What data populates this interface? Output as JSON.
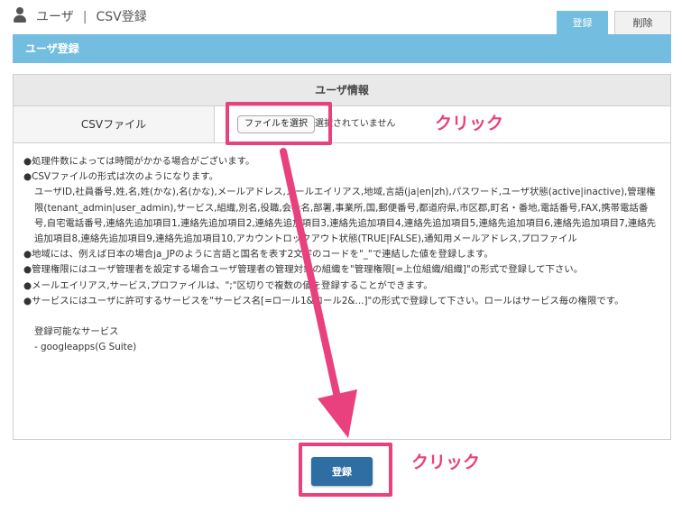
{
  "header": {
    "icon": "user-icon",
    "section": "ユーザ",
    "separator": "|",
    "page": "CSV登録"
  },
  "tabs": [
    {
      "label": "登録",
      "active": true
    },
    {
      "label": "削除",
      "active": false
    }
  ],
  "section_title": "ユーザ登録",
  "form": {
    "panel_title": "ユーザ情報",
    "csv_label": "CSVファイル",
    "file_button": "ファイルを選択",
    "file_status": "選択されていません"
  },
  "info_lines": [
    "●処理件数によっては時間がかかる場合がございます。",
    "●CSVファイルの形式は次のようになります。",
    "ユーザID,社員番号,姓,名,姓(かな),名(かな),メールアドレス,メールエイリアス,地域,言語(ja|en|zh),パスワード,ユーザ状態(active|inactive),管理権限(tenant_admin|user_admin),サービス,組織,別名,役職,会社名,部署,事業所,国,郵便番号,都道府県,市区郡,町名・番地,電話番号,FAX,携帯電話番号,自宅電話番号,連絡先追加項目1,連絡先追加項目2,連絡先追加項目3,連絡先追加項目4,連絡先追加項目5,連絡先追加項目6,連絡先追加項目7,連絡先追加項目8,連絡先追加項目9,連絡先追加項目10,アカウントロックアウト状態(TRUE|FALSE),通知用メールアドレス,プロファイル",
    "●地域には、例えば日本の場合ja_JPのように言語と国名を表す2文字のコードを\"_\"で連結した値を登録します。",
    "●管理権限にはユーザ管理者を設定する場合ユーザ管理者の管理対象の組織を\"管理権限[=上位組織/組織]\"の形式で登録して下さい。",
    "●メールエイリアス,サービス,プロファイルは、\";\"区切りで複数の値を登録することができます。",
    "●サービスにはユーザに許可するサービスを\"サービス名[=ロール1&ロール2&...]\"の形式で登録して下さい。ロールはサービス毎の権限です。",
    "",
    "登録可能なサービス",
    "- googleapps(G Suite)"
  ],
  "submit_label": "登録",
  "annotations": {
    "callout_file": "クリック",
    "callout_submit": "クリック",
    "highlight_color": "#e9407e"
  },
  "colors": {
    "accent": "#72bde0",
    "button": "#2f6ea3"
  }
}
